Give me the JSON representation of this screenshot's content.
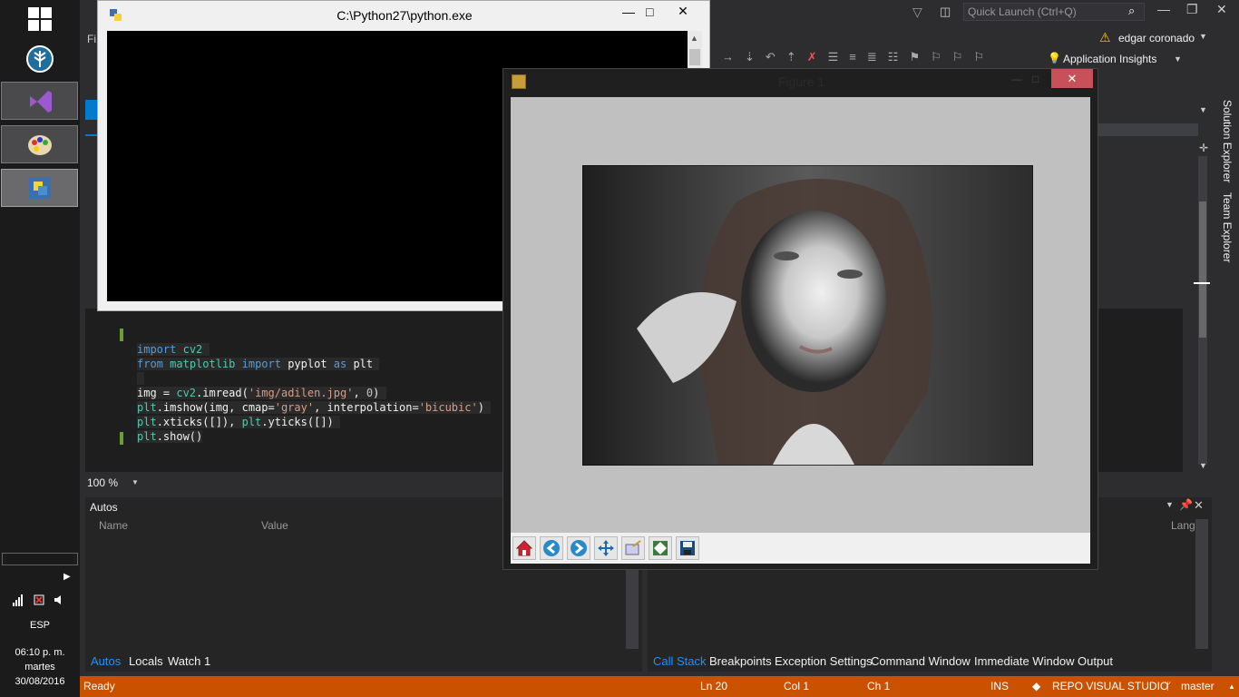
{
  "taskbar": {
    "language": "ESP",
    "time": "06:10 p. m.",
    "day": "martes",
    "date": "30/08/2016"
  },
  "vs": {
    "quick_launch_placeholder": "Quick Launch (Ctrl+Q)",
    "user": "edgar coronado",
    "app_insights": "Application Insights",
    "solution_explorer": "Solution Explorer",
    "team_explorer": "Team Explorer",
    "zoom": "100 %",
    "code_lines": [
      "import cv2",
      "from matplotlib import pyplot as plt",
      "",
      "img = cv2.imread('img/adilen.jpg', 0)",
      "plt.imshow(img, cmap='gray', interpolation='bicubic')",
      "plt.xticks([]), plt.yticks([])",
      "plt.show()"
    ],
    "autos": {
      "title": "Autos",
      "col_name": "Name",
      "col_value": "Value",
      "tabs": [
        "Autos",
        "Locals",
        "Watch 1"
      ]
    },
    "debug_tabs": [
      "Call Stack",
      "Breakpoints",
      "Exception Settings",
      "Command Window",
      "Immediate Window",
      "Output"
    ],
    "lang_col": "Lang",
    "status": {
      "ready": "Ready",
      "ln": "Ln 20",
      "col": "Col 1",
      "ch": "Ch 1",
      "ins": "INS",
      "repo": "REPO VISUAL STUDIO",
      "branch": "master"
    }
  },
  "console": {
    "title": "C:\\Python27\\python.exe"
  },
  "figure": {
    "title": "Figure 1",
    "close_label": "✕"
  }
}
